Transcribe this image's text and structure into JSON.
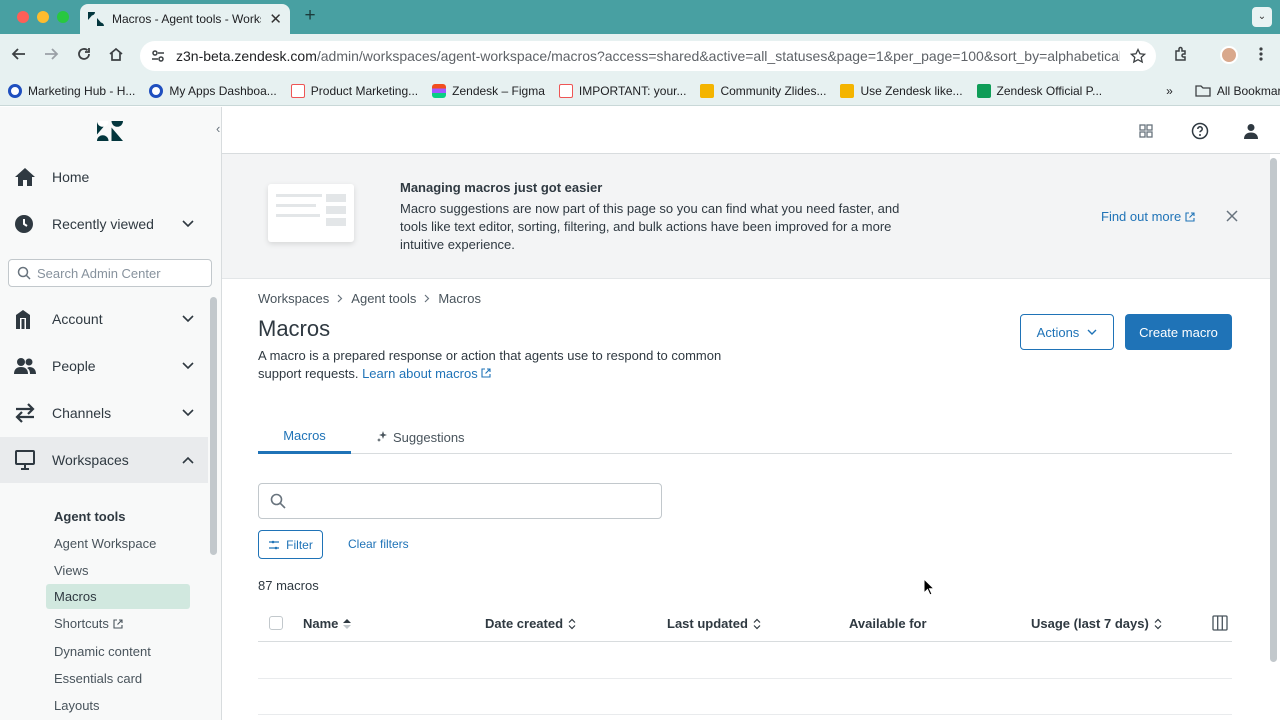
{
  "browser": {
    "tab_title": "Macros - Agent tools - Workspaces",
    "url_host": "z3n-beta.zendesk.com",
    "url_path": "/admin/workspaces/agent-workspace/macros?access=shared&active=all_statuses&page=1&per_page=100&sort_by=alphabetical&sort...",
    "bookmarks": [
      "Marketing Hub - H...",
      "My Apps Dashboa...",
      "Product Marketing...",
      "Zendesk – Figma",
      "IMPORTANT: your...",
      "Community Zlides...",
      "Use Zendesk like...",
      "Zendesk Official P..."
    ],
    "all_bookmarks": "All Bookmarks",
    "colors": {
      "tabstrip": "#48a0a2",
      "toolbar": "#e7f1f1"
    }
  },
  "sidebar": {
    "nav": [
      {
        "label": "Home",
        "icon": "home-icon"
      },
      {
        "label": "Recently viewed",
        "icon": "clock-icon"
      },
      {
        "label": "Account",
        "icon": "account-icon"
      },
      {
        "label": "People",
        "icon": "people-icon"
      },
      {
        "label": "Channels",
        "icon": "channels-icon"
      },
      {
        "label": "Workspaces",
        "icon": "workspaces-icon"
      }
    ],
    "search_placeholder": "Search Admin Center",
    "sub_heading": "Agent tools",
    "sub_items": [
      "Agent Workspace",
      "Views",
      "Macros",
      "Shortcuts",
      "Dynamic content",
      "Essentials card",
      "Layouts"
    ],
    "active_sub_item": "Macros"
  },
  "banner": {
    "title": "Managing macros just got easier",
    "body": "Macro suggestions are now part of this page so you can find what you need faster, and tools like text editor, sorting, filtering, and bulk actions have been improved for a more intuitive experience.",
    "link": "Find out more"
  },
  "main": {
    "breadcrumb": [
      "Workspaces",
      "Agent tools",
      "Macros"
    ],
    "title": "Macros",
    "description": "A macro is a prepared response or action that agents use to respond to common support requests.",
    "learn_link": "Learn about macros",
    "actions_label": "Actions",
    "create_label": "Create macro",
    "tabs": [
      "Macros",
      "Suggestions"
    ],
    "search_placeholder": "",
    "filter_label": "Filter",
    "clear_label": "Clear filters",
    "count": "87 macros",
    "columns": [
      "Name",
      "Date created",
      "Last updated",
      "Available for",
      "Usage (last 7 days)"
    ],
    "accent": "#1f73b7"
  }
}
